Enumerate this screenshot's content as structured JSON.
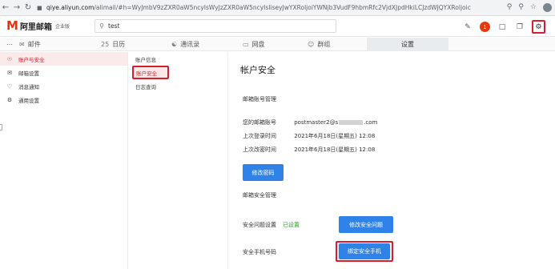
{
  "browser": {
    "url_host": "qiye.aliyun.com",
    "url_path": "/alimail/#h=WyJmbV9zZXR0aW5ncyIsWyJzZXR0aW5ncyIsIiseyJwYXRoljoiYWNjb3VudF9hbmRfc2VjdXJpdHkiLCJzdWJQYXRoljoic2V0dGluZ3NfYW...",
    "icons": [
      "back-icon",
      "forward-icon",
      "reload-icon",
      "key-icon",
      "zoom-icon",
      "star-icon",
      "profile-icon"
    ]
  },
  "header": {
    "logo_mark": "M",
    "logo_text": "阿里邮箱",
    "logo_edition": "企业版",
    "search_value": "test",
    "notification_count": "1"
  },
  "modules": {
    "tabs": [
      {
        "label": "邮件",
        "icon": "mail-icon"
      },
      {
        "label": "日历",
        "icon": "calendar-icon",
        "icon_text": "25"
      },
      {
        "label": "通讯录",
        "icon": "contacts-icon"
      },
      {
        "label": "网盘",
        "icon": "drive-icon"
      },
      {
        "label": "群组",
        "icon": "group-icon"
      },
      {
        "label": "设置",
        "icon": "settings-icon"
      }
    ]
  },
  "leftnav": {
    "items": [
      {
        "label": "账户与安全",
        "icon": "user-icon",
        "active": true
      },
      {
        "label": "邮箱设置",
        "icon": "mail-settings-icon"
      },
      {
        "label": "消息通知",
        "icon": "bell-icon"
      },
      {
        "label": "通用设置",
        "icon": "gear-icon"
      }
    ]
  },
  "subnav": {
    "items": [
      {
        "label": "账户信息"
      },
      {
        "label": "账户安全",
        "active": true
      },
      {
        "label": "日志查询"
      }
    ]
  },
  "content": {
    "title": "帐户安全",
    "mailbox_section": "邮箱账号管理",
    "account_label": "您的邮箱账号",
    "account_prefix": "postmaster2@s",
    "account_suffix": ".com",
    "last_login_label": "上次登录时间",
    "last_login_value": "2021年6月18日(星期五) 12:08",
    "last_change_label": "上次改密时间",
    "last_change_value": "2021年6月18日(星期五) 12:08",
    "change_password_button": "修改密码",
    "security_section": "邮箱安全管理",
    "question_label": "安全问题设置",
    "question_status": "已设置",
    "modify_question_button": "修改安全问题",
    "phone_label": "安全手机号码",
    "bind_phone_button": "绑定安全手机"
  },
  "colors": {
    "brand_red": "#e8320f",
    "highlight_red": "#d81e2c",
    "primary_blue": "#2f83e8",
    "status_green": "#2aa52a"
  }
}
